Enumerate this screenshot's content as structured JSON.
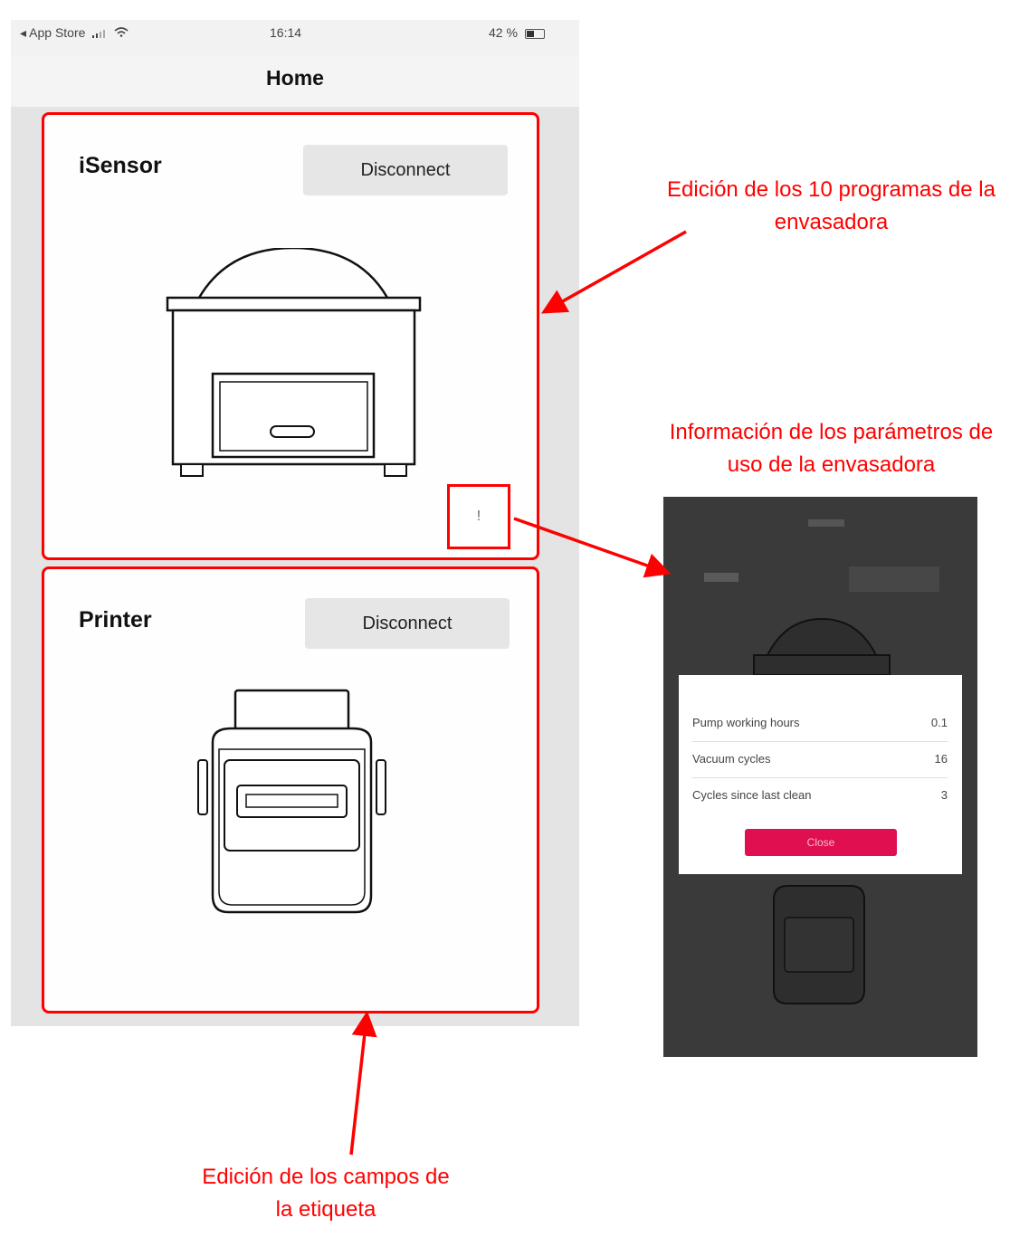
{
  "status_bar": {
    "carrier": "◂ App Store",
    "time": "16:14",
    "battery": "42 %"
  },
  "nav": {
    "title": "Home"
  },
  "devices": [
    {
      "name": "iSensor",
      "button_label": "Disconnect",
      "info_label": "!"
    },
    {
      "name": "Printer",
      "button_label": "Disconnect"
    }
  ],
  "annotations": {
    "programs": [
      "Edición de los 10 programas de la",
      "envasadora"
    ],
    "info": [
      "Información de los parámetros de",
      "uso de la envasadora"
    ],
    "label_fields": [
      "Edición de los campos de",
      "la etiqueta"
    ]
  },
  "info_popup": {
    "rows": [
      {
        "label": "Pump working hours",
        "value": "0.1"
      },
      {
        "label": "Vacuum cycles",
        "value": "16"
      },
      {
        "label": "Cycles since last clean",
        "value": "3"
      }
    ],
    "button_label": "Close",
    "button_color": "#e01050"
  },
  "colors": {
    "annotation": "#ff0000",
    "screen_bg": "#e4e4e4",
    "modal_bg": "#3a3a3a"
  }
}
